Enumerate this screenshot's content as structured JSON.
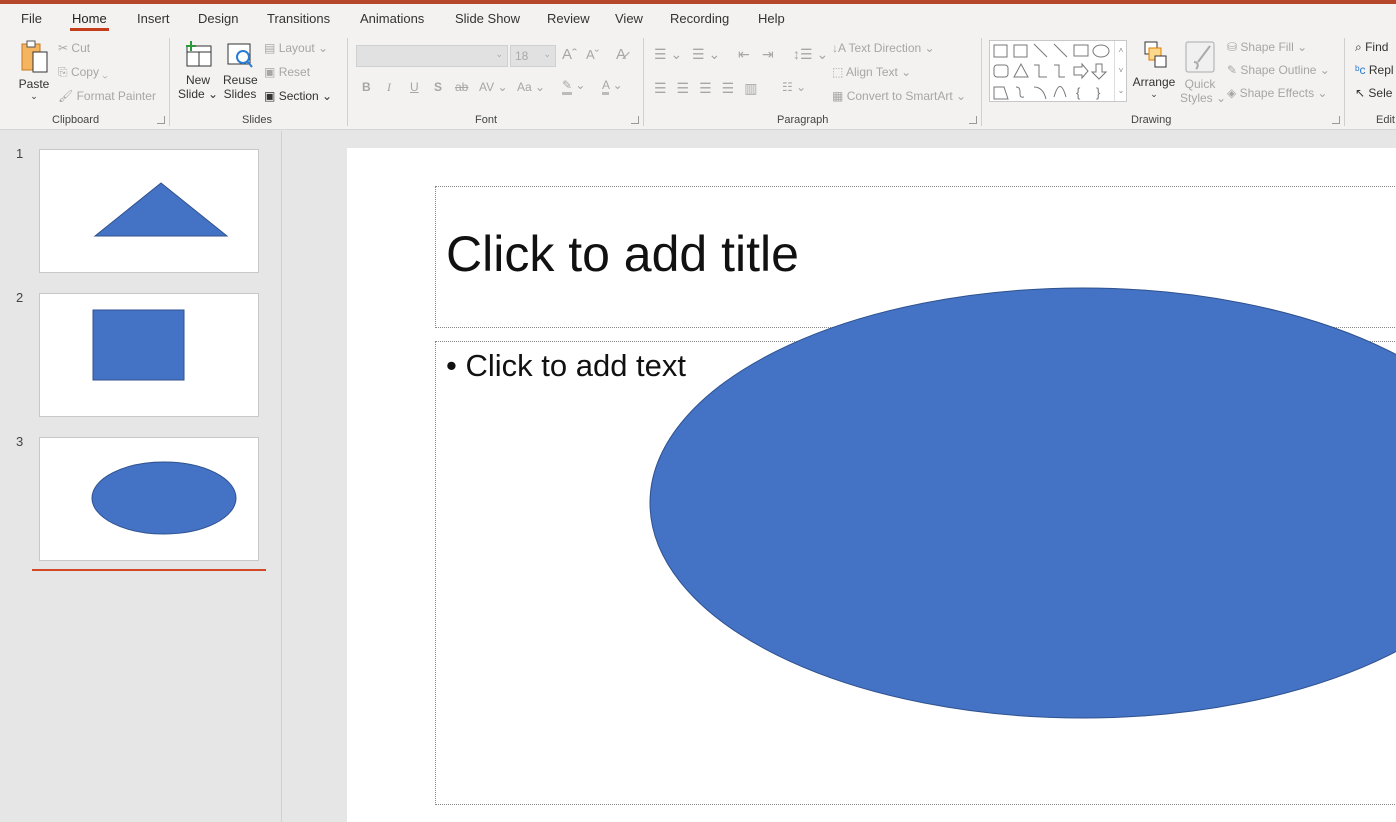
{
  "tabs": [
    "File",
    "Home",
    "Insert",
    "Design",
    "Transitions",
    "Animations",
    "Slide Show",
    "Review",
    "View",
    "Recording",
    "Help"
  ],
  "active_tab": "Home",
  "clipboard": {
    "paste": "Paste",
    "cut": "Cut",
    "copy": "Copy",
    "format_painter": "Format Painter",
    "label": "Clipboard"
  },
  "slides_group": {
    "new_slide_1": "New",
    "new_slide_2": "Slide",
    "reuse_1": "Reuse",
    "reuse_2": "Slides",
    "layout": "Layout",
    "reset": "Reset",
    "section": "Section",
    "label": "Slides"
  },
  "font": {
    "font_name": "",
    "font_size": "18",
    "bold": "B",
    "italic": "I",
    "underline": "U",
    "shadow": "S",
    "strike": "ab",
    "spacing": "AV",
    "case": "Aa",
    "color": "A",
    "grow": "A",
    "shrink": "A",
    "label": "Font"
  },
  "paragraph": {
    "text_direction": "Text Direction",
    "align_text": "Align Text",
    "smartart": "Convert to SmartArt",
    "label": "Paragraph"
  },
  "drawing": {
    "arrange": "Arrange",
    "quick_1": "Quick",
    "quick_2": "Styles",
    "shape_fill": "Shape Fill",
    "shape_outline": "Shape Outline",
    "shape_effects": "Shape Effects",
    "label": "Drawing"
  },
  "editing": {
    "find": "Find",
    "replace": "Repl",
    "select": "Sele",
    "label": "Edit"
  },
  "thumbnails": [
    {
      "number": "1",
      "shape": "triangle"
    },
    {
      "number": "2",
      "shape": "rectangle"
    },
    {
      "number": "3",
      "shape": "ellipse"
    }
  ],
  "slide": {
    "title_placeholder": "Click to add title",
    "body_placeholder": "Click to add text",
    "bullet": "•"
  },
  "colors": {
    "accent": "#c43e1c",
    "shape_fill": "#4472c4",
    "shape_stroke": "#2f528f"
  }
}
